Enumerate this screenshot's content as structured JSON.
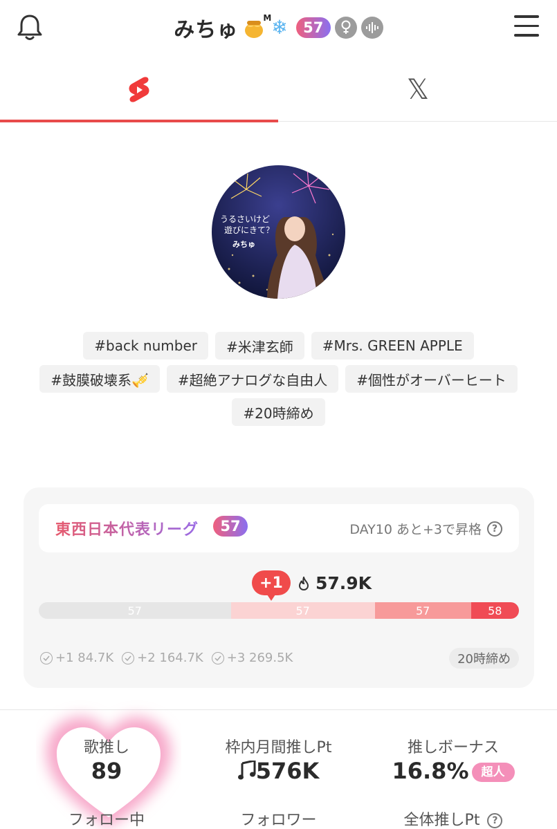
{
  "header": {
    "username": "みちゅ",
    "level": "57",
    "honey_mark": "M",
    "icons": [
      "bell-icon",
      "honey-pot-icon",
      "snowflake-icon",
      "female-icon",
      "voice-wave-icon",
      "menu-icon"
    ]
  },
  "tabs": [
    {
      "name": "shorts",
      "icon": "shorts-icon",
      "active": true
    },
    {
      "name": "x",
      "label": "𝕏",
      "icon": "x-logo-icon",
      "active": false
    }
  ],
  "profile": {
    "avatar_text_line1": "うるさいけど",
    "avatar_text_line2": "遊びにきて？",
    "avatar_name": "みちゅ"
  },
  "tags": [
    [
      "#back number",
      "#米津玄師",
      "#Mrs. GREEN APPLE"
    ],
    [
      "#鼓膜破壊系🎺",
      "#超絶アナログな自由人",
      "#個性がオーバーヒート"
    ],
    [
      "#20時締め"
    ]
  ],
  "league": {
    "title": "東西日本代表リーグ",
    "badge": "57",
    "status": "DAY10 あと+3で昇格",
    "help": "?",
    "rank_change": "+1",
    "score": "57.9K",
    "bar_segments": [
      {
        "label": "57",
        "color": "#e6e6e6",
        "share": 0.4
      },
      {
        "label": "57",
        "color": "#fbd3d3",
        "share": 0.3
      },
      {
        "label": "57",
        "color": "#f79a9a",
        "share": 0.2
      },
      {
        "label": "58",
        "color": "#f04b55",
        "share": 0.1
      }
    ],
    "milestones": [
      "+1 84.7K",
      "+2 164.7K",
      "+3 269.5K"
    ],
    "deadline": "20時締め"
  },
  "stats": {
    "col1_label": "歌推し",
    "col1_value": "89",
    "col2_label": "枠内月間推しPt",
    "col2_value": "576K",
    "col3_label": "推しボーナス",
    "col3_value": "16.8%",
    "col3_badge": "超人",
    "row2_col1": "フォロー中",
    "row2_col2": "フォロワー",
    "row2_col3": "全体推しPt",
    "help": "?"
  },
  "colors": {
    "accent_red": "#e84b4b",
    "badge_pink": "#f48fb9"
  }
}
